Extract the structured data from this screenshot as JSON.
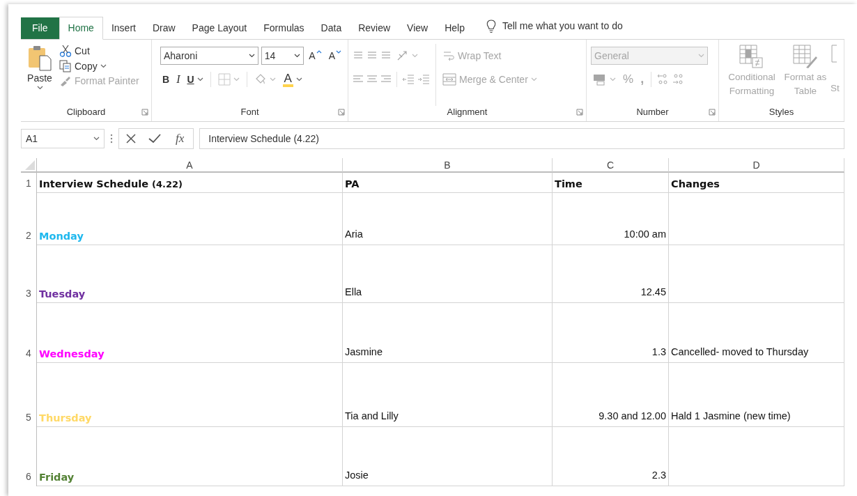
{
  "tabs": [
    {
      "label": "File",
      "kind": "file",
      "selected": false
    },
    {
      "label": "Home",
      "kind": "tab",
      "selected": true
    },
    {
      "label": "Insert",
      "kind": "tab",
      "selected": false
    },
    {
      "label": "Draw",
      "kind": "tab",
      "selected": false
    },
    {
      "label": "Page Layout",
      "kind": "tab",
      "selected": false
    },
    {
      "label": "Formulas",
      "kind": "tab",
      "selected": false
    },
    {
      "label": "Data",
      "kind": "tab",
      "selected": false
    },
    {
      "label": "Review",
      "kind": "tab",
      "selected": false
    },
    {
      "label": "View",
      "kind": "tab",
      "selected": false
    },
    {
      "label": "Help",
      "kind": "tab",
      "selected": false
    }
  ],
  "tell_me": {
    "placeholder": "Tell me what you want to do"
  },
  "ribbon": {
    "clipboard": {
      "label": "Clipboard",
      "paste": {
        "label": "Paste",
        "disabled": false
      },
      "cut": {
        "label": "Cut",
        "disabled": false
      },
      "copy": {
        "label": "Copy",
        "disabled": false
      },
      "format_painter": {
        "label": "Format Painter",
        "disabled": true
      }
    },
    "font": {
      "label": "Font",
      "font_name": "Aharoni",
      "font_size": "14",
      "grow": {
        "label": "A"
      },
      "shrink": {
        "label": "A"
      },
      "bold": {
        "label": "B"
      },
      "italic": {
        "label": "I"
      },
      "underline": {
        "label": "U"
      },
      "borders": {
        "disabled": true
      },
      "fill": {
        "disabled": true
      },
      "font_color": {
        "label": "A",
        "disabled": false
      }
    },
    "alignment": {
      "label": "Alignment",
      "disabled": true,
      "wrap_text": {
        "label": "Wrap Text"
      },
      "merge_center": {
        "label": "Merge & Center"
      }
    },
    "number": {
      "label": "Number",
      "disabled": true,
      "format": {
        "value": "General"
      },
      "percent": {
        "label": "%"
      },
      "comma": {
        "label": ","
      }
    },
    "styles": {
      "label": "Styles",
      "disabled": true,
      "conditional": {
        "label": "Conditional Formatting"
      },
      "format_table": {
        "label": "Format as Table"
      },
      "cell_styles": {
        "label": "St"
      }
    }
  },
  "formula_bar": {
    "name_box": "A1",
    "fx": "fx",
    "value": "Interview Schedule (4.22)"
  },
  "sheet": {
    "columns": [
      "A",
      "B",
      "C",
      "D"
    ],
    "header_row": {
      "number": "1",
      "title": "Interview Schedule",
      "title_note": "(4.22)",
      "cells": [
        "PA",
        "Time",
        "Changes"
      ]
    },
    "rows": [
      {
        "number": "2",
        "day": "Monday",
        "color": "#1fb8ee",
        "pa": "Aria",
        "time": "10:00 am"
      },
      {
        "number": "3",
        "day": "Tuesday",
        "color": "#7030a0",
        "pa": "Ella",
        "time": "12.45"
      },
      {
        "number": "4",
        "day": "Wednesday",
        "color": "#ff00ff",
        "pa": "Jasmine",
        "time": "1.3",
        "changes": "Cancelled- moved to Thursday"
      },
      {
        "number": "5",
        "day": "Thursday",
        "color": "#ffd966",
        "pa": "Tia and Lilly",
        "time": "9.30 and 12.00",
        "changes": "Hald 1 Jasmine (new time)"
      },
      {
        "number": "6",
        "day": "Friday",
        "color": "#548235",
        "pa": "Josie",
        "time": "2.3"
      }
    ]
  }
}
